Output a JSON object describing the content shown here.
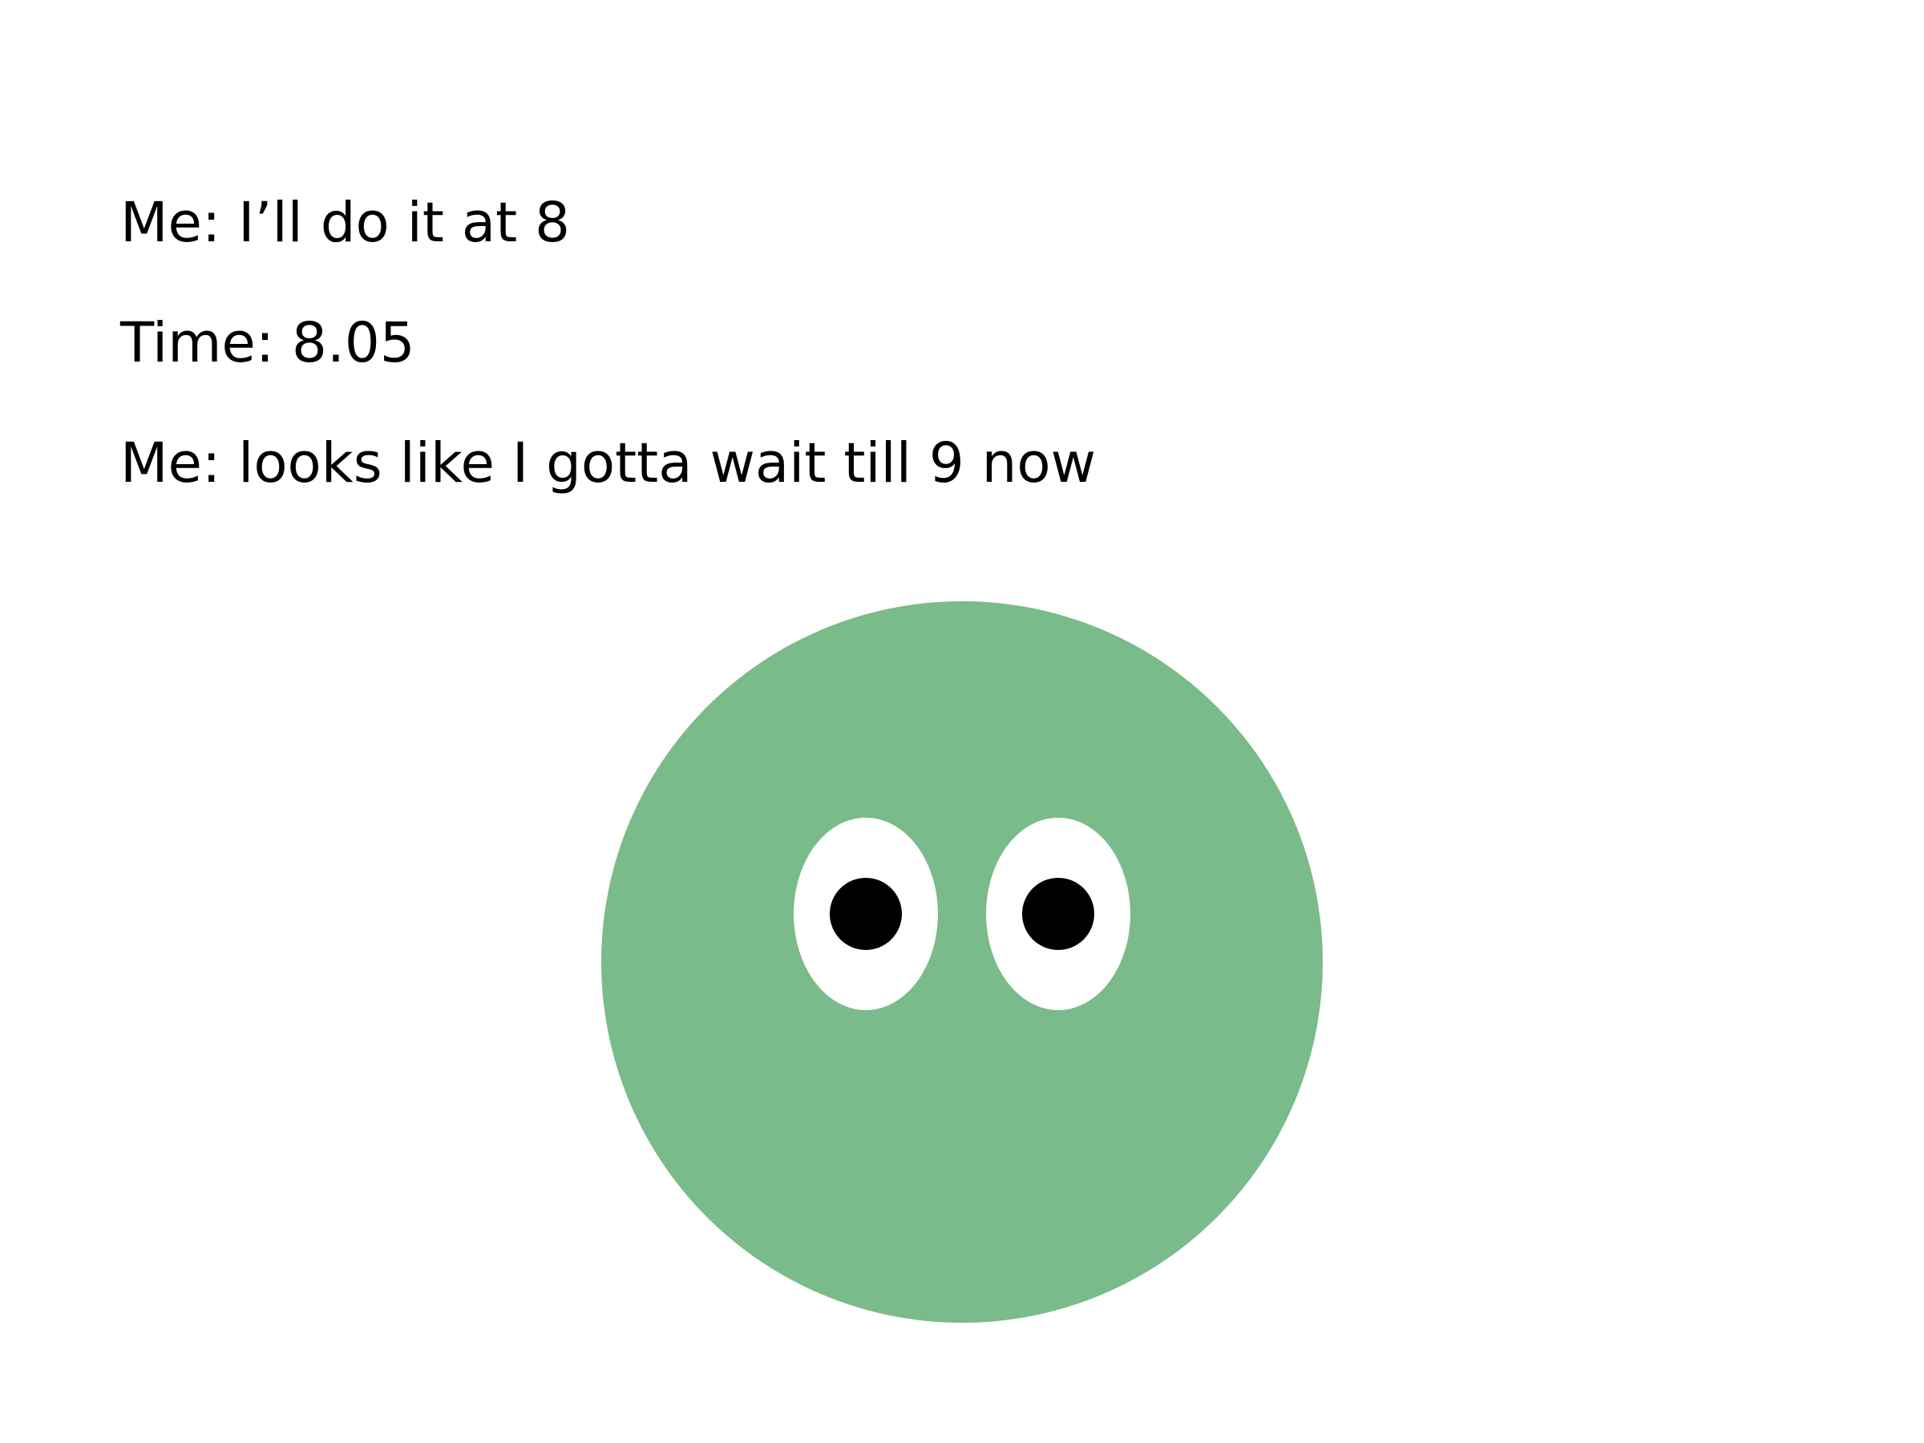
{
  "meme": {
    "lines": [
      "Me: I’ll do it at 8",
      "Time: 8.05",
      "Me: looks like I gotta wait till 9 now"
    ]
  },
  "character": {
    "face_color": "#79bb8a",
    "eye_white_color": "#ffffff",
    "pupil_color": "#000000"
  }
}
